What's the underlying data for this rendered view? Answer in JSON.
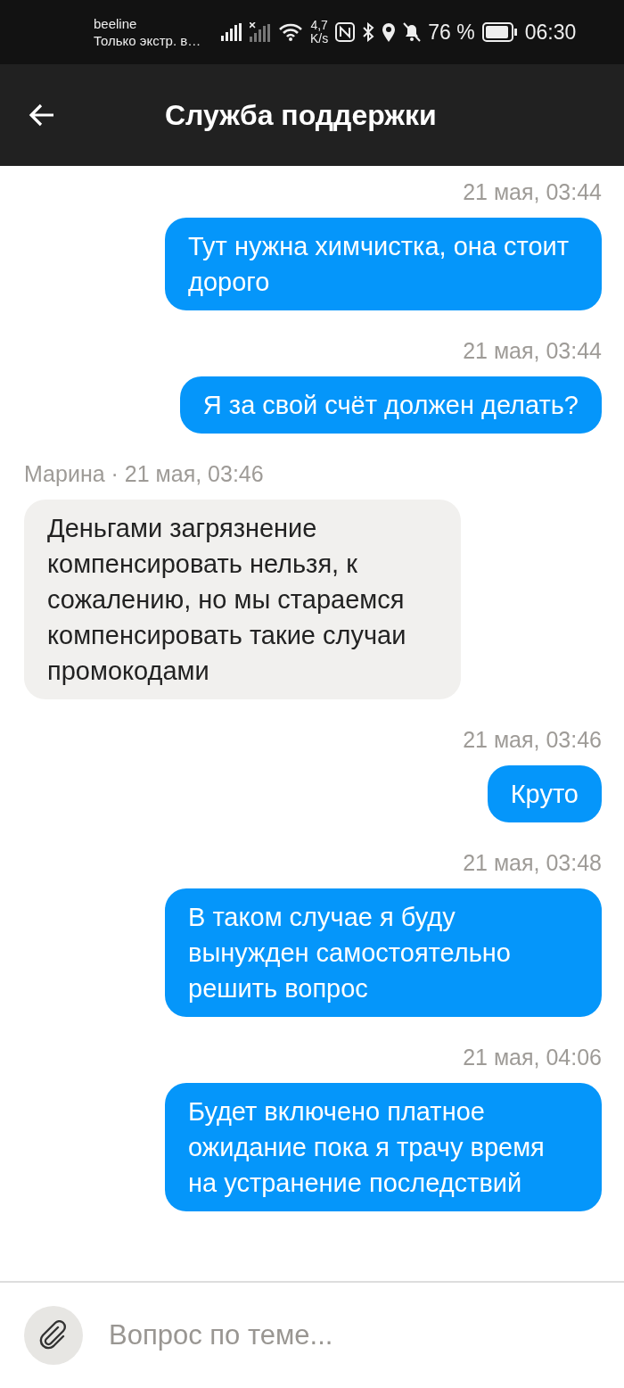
{
  "status_bar": {
    "carrier": "beeline",
    "carrier_status": "Только экстр. в…",
    "speed_value": "4,7",
    "speed_unit": "K/s",
    "battery": "76 %",
    "time": "06:30"
  },
  "header": {
    "title": "Служба поддержки"
  },
  "messages": [
    {
      "kind": "outgoing",
      "time": "21 мая, 03:44",
      "text": "Тут нужна химчистка, она стоит дорого"
    },
    {
      "kind": "outgoing",
      "time": "21 мая, 03:44",
      "text": "Я за свой счёт должен делать?"
    },
    {
      "kind": "incoming",
      "time": "Марина · 21 мая, 03:46",
      "text": "Деньгами загрязнение компенсировать нельзя, к сожалению, но мы стараемся компенсировать такие случаи промокодами"
    },
    {
      "kind": "outgoing",
      "time": "21 мая, 03:46",
      "text": "Круто"
    },
    {
      "kind": "outgoing",
      "time": "21 мая, 03:48",
      "text": "В таком случае я буду вынужден самостоятельно решить вопрос"
    },
    {
      "kind": "outgoing",
      "time": "21 мая, 04:06",
      "text": "Будет включено платное ожидание пока я трачу время на устранение последствий"
    }
  ],
  "composer": {
    "placeholder": "Вопрос по теме..."
  }
}
